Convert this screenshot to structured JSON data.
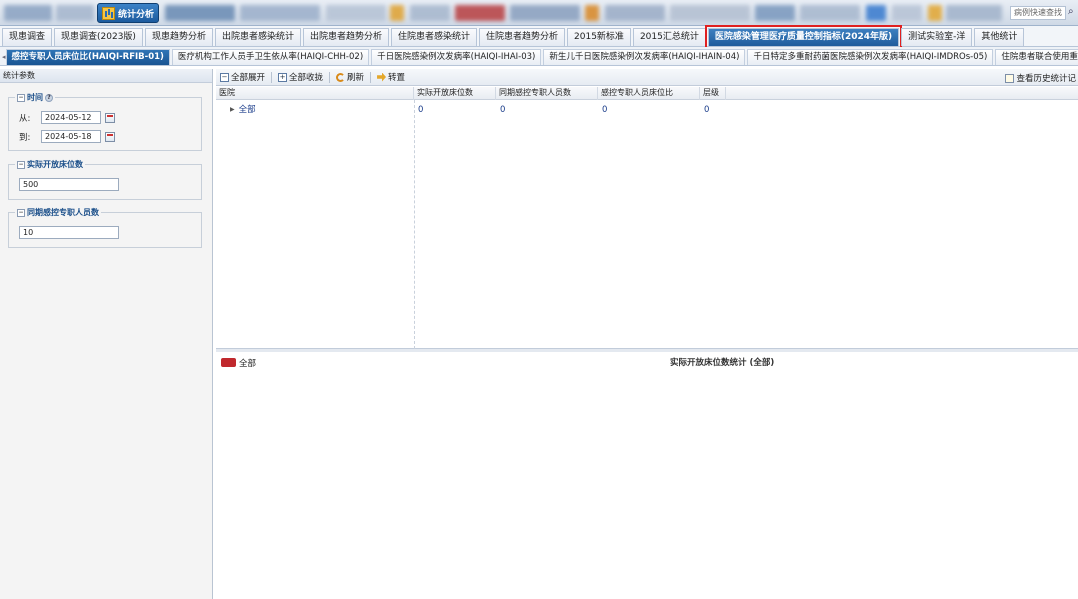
{
  "topbar": {
    "module_label": "统计分析",
    "quick_search_placeholder": "病例快速查找"
  },
  "main_tabs": [
    {
      "label": "现患调查"
    },
    {
      "label": "现患调查(2023版)"
    },
    {
      "label": "现患趋势分析"
    },
    {
      "label": "出院患者感染统计"
    },
    {
      "label": "出院患者趋势分析"
    },
    {
      "label": "住院患者感染统计"
    },
    {
      "label": "住院患者趋势分析"
    },
    {
      "label": "2015新标准"
    },
    {
      "label": "2015汇总统计"
    },
    {
      "label": "医院感染管理医疗质量控制指标(2024年版)",
      "active": true
    },
    {
      "label": "测试实验室-洋"
    },
    {
      "label": "其他统计"
    }
  ],
  "sub_tabs": [
    {
      "label": "感控专职人员床位比(HAIQI-RFIB-01)",
      "active": true
    },
    {
      "label": "医疗机构工作人员手卫生依从率(HAIQI-CHH-02)"
    },
    {
      "label": "千日医院感染例次发病率(HAIQI-IHAI-03)"
    },
    {
      "label": "新生儿千日医院感染例次发病率(HAIQI-IHAIN-04)"
    },
    {
      "label": "千日特定多重耐药菌医院感染例次发病率(HAIQI-IMDROs-05)"
    },
    {
      "label": "住院患者联合使用重"
    }
  ],
  "params": {
    "panel_title": "统计参数",
    "time_section": {
      "legend": "时间",
      "from_label": "从:",
      "from_value": "2024-05-12",
      "to_label": "到:",
      "to_value": "2024-05-18"
    },
    "beds_section": {
      "legend": "实际开放床位数",
      "value": "500"
    },
    "staff_section": {
      "legend": "同期感控专职人员数",
      "value": "10"
    }
  },
  "toolbar": {
    "expand_all": "全部展开",
    "collapse_all": "全部收拢",
    "refresh": "刷新",
    "forward": "转置",
    "view_history": "查看历史统计记"
  },
  "grid": {
    "columns": [
      "医院",
      "实际开放床位数",
      "同期感控专职人员数",
      "感控专职人员床位比",
      "层级"
    ],
    "rows": [
      {
        "name": "全部",
        "beds": "0",
        "staff": "0",
        "ratio": "0",
        "level": "0"
      }
    ]
  },
  "chart": {
    "legend_label": "全部",
    "legend_color": "#c0282d",
    "title": "实际开放床位数统计 (全部)"
  }
}
